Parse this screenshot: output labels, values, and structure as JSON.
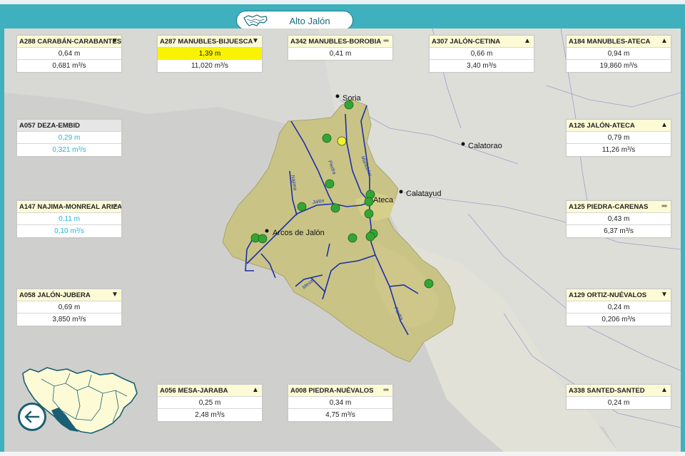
{
  "header": {
    "title": "Alto Jalón"
  },
  "colors": {
    "header_bg": "#3fb0bd",
    "panel_head": "#fdfbd6",
    "highlight": "#f9f200",
    "cyan_value": "#23b3d6",
    "station_green": "#33a533",
    "station_yellow": "#f6ef2d",
    "basin_fill": "#c9c486",
    "river": "#1c2fa8"
  },
  "icons": {
    "back": "arrow-left-icon",
    "trend_down": "arrow-down-icon",
    "trend_up": "arrow-up-icon",
    "trend_stable": "equals-icon"
  },
  "towns": [
    {
      "name": "Soria"
    },
    {
      "name": "Calatorao"
    },
    {
      "name": "Calatayud"
    },
    {
      "name": "Ateca"
    },
    {
      "name": "Arcos de Jalón"
    }
  ],
  "rivers": [
    {
      "name": "Manubles"
    },
    {
      "name": "Piedra"
    },
    {
      "name": "Nájima"
    },
    {
      "name": "Jalón"
    },
    {
      "name": "Mesa"
    },
    {
      "name": "Piedra"
    }
  ],
  "stations": [
    {
      "title": "A288 CARABÁN-CARABANTES",
      "trend": "▼",
      "trend_name": "down",
      "level": "0,64  m",
      "flow": "0,681  m³/s"
    },
    {
      "title": "A287 MANUBLES-BIJUESCA",
      "trend": "▼",
      "trend_name": "down",
      "level": "1,39  m",
      "flow": "11,020  m³/s"
    },
    {
      "title": "A342 MANUBLES-BOROBIA",
      "trend": "═",
      "trend_name": "stable",
      "level": "0,41  m",
      "flow": ""
    },
    {
      "title": "A307 JALÓN-CETINA",
      "trend": "▲",
      "trend_name": "up",
      "level": "0,66  m",
      "flow": "3,40  m³/s"
    },
    {
      "title": "A184 MANUBLES-ATECA",
      "trend": "▲",
      "trend_name": "up",
      "level": "0,94  m",
      "flow": "19,860  m³/s"
    },
    {
      "title": "A057 DEZA-EMBID",
      "trend": "",
      "trend_name": "none",
      "level": "0,29  m",
      "flow": "0,321  m³/s"
    },
    {
      "title": "A126 JALÓN-ATECA",
      "trend": "▲",
      "trend_name": "up",
      "level": "0,79  m",
      "flow": "11,26  m³/s"
    },
    {
      "title": "A147 NAJIMA-MONREAL ARIZA",
      "trend": "═",
      "trend_name": "stable",
      "level": "0,11  m",
      "flow": "0,10  m³/s"
    },
    {
      "title": "A125 PIEDRA-CARENAS",
      "trend": "═",
      "trend_name": "stable",
      "level": "0,43  m",
      "flow": "6,37  m³/s"
    },
    {
      "title": "A058 JALÓN-JUBERA",
      "trend": "▼",
      "trend_name": "down",
      "level": "0,69  m",
      "flow": "3,850  m³/s"
    },
    {
      "title": "A129 ORTIZ-NUÉVALOS",
      "trend": "▼",
      "trend_name": "down",
      "level": "0,24  m",
      "flow": "0,206  m³/s"
    },
    {
      "title": "A056 MESA-JARABA",
      "trend": "▲",
      "trend_name": "up",
      "level": "0,25  m",
      "flow": "2,48  m³/s"
    },
    {
      "title": "A008 PIEDRA-NUÉVALOS",
      "trend": "═",
      "trend_name": "stable",
      "level": "0,34  m",
      "flow": "4,75  m³/s"
    },
    {
      "title": "A338 SANTED-SANTED",
      "trend": "▲",
      "trend_name": "up",
      "level": "0,24  m",
      "flow": ""
    }
  ]
}
